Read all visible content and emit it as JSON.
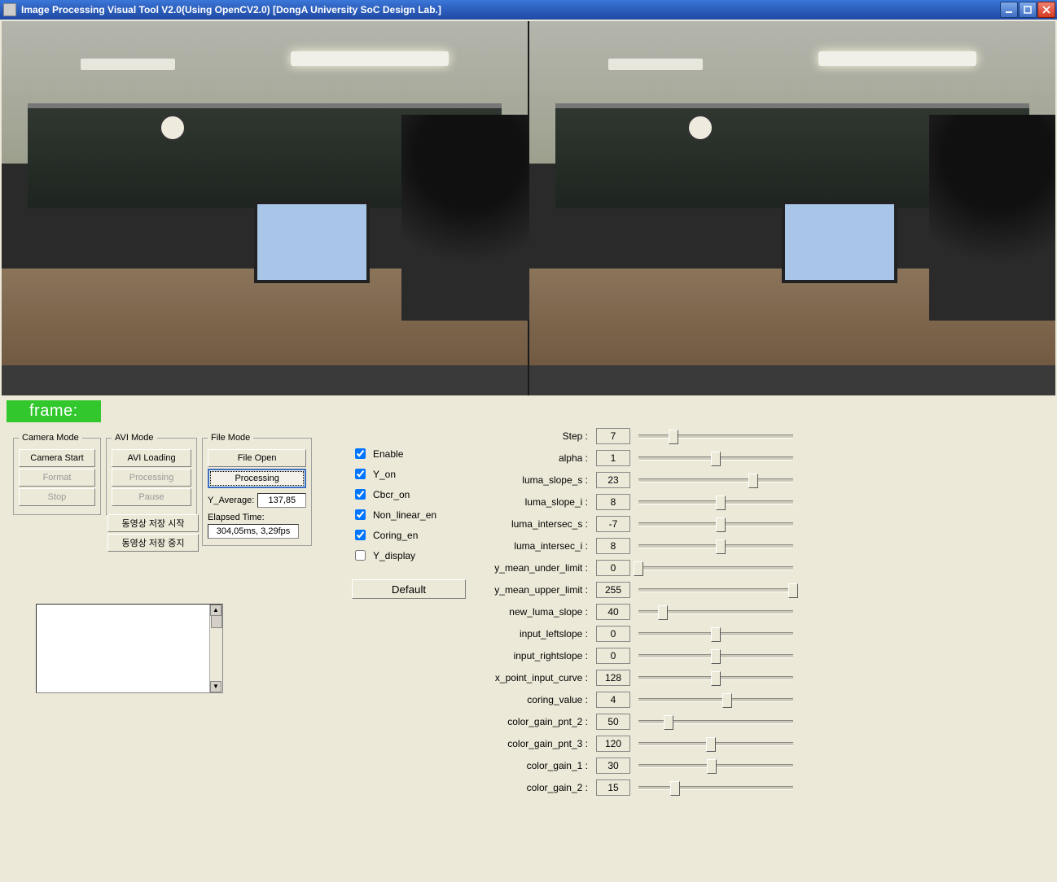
{
  "window": {
    "title": "Image Processing Visual Tool V2.0(Using OpenCV2.0) [DongA University SoC Design Lab.]"
  },
  "frame_label": "frame:",
  "groups": {
    "camera": {
      "legend": "Camera Mode",
      "start": "Camera Start",
      "format": "Format",
      "stop": "Stop"
    },
    "avi": {
      "legend": "AVI Mode",
      "loading": "AVI Loading",
      "processing": "Processing",
      "pause": "Pause",
      "save_start": "동영상 저장 시작",
      "save_stop": "동영상 저장 중지"
    },
    "file": {
      "legend": "File Mode",
      "open": "File Open",
      "processing": "Processing",
      "yavg_label": "Y_Average:",
      "yavg_value": "137,85",
      "elapsed_label": "Elapsed Time:",
      "elapsed_value": "304,05ms, 3,29fps"
    }
  },
  "checks": {
    "enable": {
      "label": "Enable",
      "checked": true
    },
    "y_on": {
      "label": "Y_on",
      "checked": true
    },
    "cbcr_on": {
      "label": "Cbcr_on",
      "checked": true
    },
    "non_linear_en": {
      "label": "Non_linear_en",
      "checked": true
    },
    "coring_en": {
      "label": "Coring_en",
      "checked": true
    },
    "y_display": {
      "label": "Y_display",
      "checked": false
    }
  },
  "default_label": "Default",
  "sliders": [
    {
      "name": "Step",
      "value": 7,
      "min": 0,
      "max": 31
    },
    {
      "name": "alpha",
      "value": 1,
      "min": 0,
      "max": 2
    },
    {
      "name": "luma_slope_s",
      "value": 23,
      "min": 0,
      "max": 31
    },
    {
      "name": "luma_slope_i",
      "value": 8,
      "min": 0,
      "max": 15
    },
    {
      "name": "luma_intersec_s",
      "value": -7,
      "min": -15,
      "max": 0
    },
    {
      "name": "luma_intersec_i",
      "value": 8,
      "min": 0,
      "max": 15
    },
    {
      "name": "y_mean_under_limit",
      "value": 0,
      "min": 0,
      "max": 255
    },
    {
      "name": "y_mean_upper_limit",
      "value": 255,
      "min": 0,
      "max": 255
    },
    {
      "name": "new_luma_slope",
      "value": 40,
      "min": 0,
      "max": 255
    },
    {
      "name": "input_leftslope",
      "value": 0,
      "min": -15,
      "max": 15
    },
    {
      "name": "input_rightslope",
      "value": 0,
      "min": -15,
      "max": 15
    },
    {
      "name": "x_point_input_curve",
      "value": 128,
      "min": 0,
      "max": 255
    },
    {
      "name": "coring_value",
      "value": 4,
      "min": 0,
      "max": 7
    },
    {
      "name": "color_gain_pnt_2",
      "value": 50,
      "min": 0,
      "max": 255
    },
    {
      "name": "color_gain_pnt_3",
      "value": 120,
      "min": 0,
      "max": 255
    },
    {
      "name": "color_gain_1",
      "value": 30,
      "min": 0,
      "max": 63
    },
    {
      "name": "color_gain_2",
      "value": 15,
      "min": 0,
      "max": 63
    }
  ]
}
